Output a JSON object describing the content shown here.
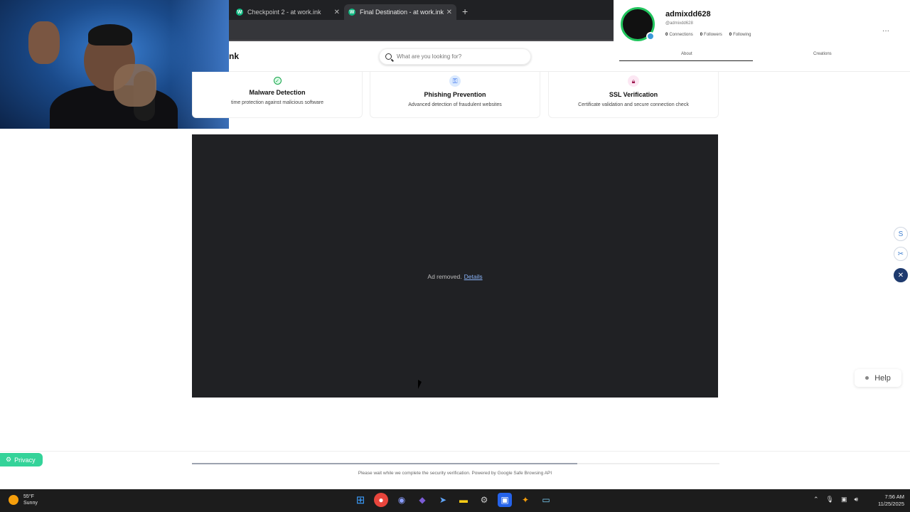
{
  "browser": {
    "tabs": [
      {
        "label": "Checkpoint 2 - at work.ink",
        "active": false
      },
      {
        "label": "Final Destination - at work.ink",
        "active": true
      }
    ]
  },
  "site": {
    "logo_text": "nk",
    "search_placeholder": "What are you looking for?"
  },
  "features": [
    {
      "title": "Malware Detection",
      "desc": "time protection against malicious software",
      "icon": "check-circle-icon"
    },
    {
      "title": "Phishing Prevention",
      "desc": "Advanced detection of fraudulent websites",
      "icon": "key-icon"
    },
    {
      "title": "SSL Verification",
      "desc": "Certificate validation and secure connection check",
      "icon": "lock-icon"
    }
  ],
  "ad": {
    "removed_text": "Ad removed.",
    "details_link": "Details"
  },
  "profile": {
    "name": "admixdd628",
    "handle": "@admixdd628",
    "connections_count": "0",
    "connections_label": "Connections",
    "followers_count": "0",
    "followers_label": "Followers",
    "following_count": "0",
    "following_label": "Following",
    "tab_about": "About",
    "tab_creations": "Creations"
  },
  "help": {
    "label": "Help"
  },
  "privacy": {
    "label": "Privacy"
  },
  "footer": {
    "message": "Please wait while we complete the security verification. Powered by Google Safe Browsing API",
    "progress_fraction": 0.73
  },
  "taskbar": {
    "temperature": "55°F",
    "condition": "Sunny",
    "time": "7:56 AM",
    "date": "11/25/2025"
  },
  "colors": {
    "ad_background": "#202124",
    "privacy_green": "#34d399",
    "link_blue": "#8ab4f8"
  }
}
